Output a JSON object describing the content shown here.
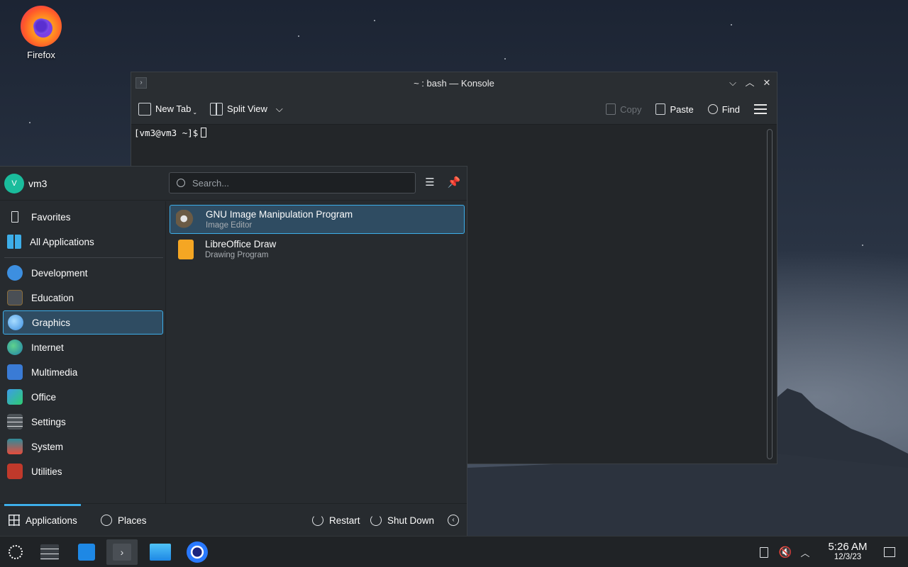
{
  "desktop": {
    "icons": [
      {
        "label": "Firefox",
        "icon": "firefox-icon"
      }
    ]
  },
  "konsole": {
    "title": "~ : bash — Konsole",
    "toolbar": {
      "new_tab": "New Tab",
      "split_view": "Split View",
      "copy": "Copy",
      "paste": "Paste",
      "find": "Find"
    },
    "prompt": "[vm3@vm3 ~]$"
  },
  "kickoff": {
    "user": {
      "initial": "V",
      "name": "vm3"
    },
    "search": {
      "placeholder": "Search..."
    },
    "categories_top": [
      {
        "label": "Favorites",
        "icon": "bookmark-icon"
      },
      {
        "label": "All Applications",
        "icon": "grid-icon"
      }
    ],
    "categories": [
      {
        "label": "Development",
        "icon": "development-icon",
        "color": "#3d8fe0"
      },
      {
        "label": "Education",
        "icon": "education-icon",
        "color": "#4a4f55"
      },
      {
        "label": "Graphics",
        "icon": "graphics-icon",
        "color": "#5aa9e6",
        "selected": true
      },
      {
        "label": "Internet",
        "icon": "globe-icon",
        "color": "#2fa3a8"
      },
      {
        "label": "Multimedia",
        "icon": "multimedia-icon",
        "color": "#3a7bd5"
      },
      {
        "label": "Office",
        "icon": "office-icon",
        "color": "#3d9be9"
      },
      {
        "label": "Settings",
        "icon": "settings-icon",
        "color": "#4d5358"
      },
      {
        "label": "System",
        "icon": "system-icon",
        "color": "#2e8b9a"
      },
      {
        "label": "Utilities",
        "icon": "toolbox-icon",
        "color": "#c0392b"
      }
    ],
    "apps": [
      {
        "name": "GNU Image Manipulation Program",
        "desc": "Image Editor",
        "icon": "gimp-icon",
        "selected": true
      },
      {
        "name": "LibreOffice Draw",
        "desc": "Drawing Program",
        "icon": "libreoffice-draw-icon"
      }
    ],
    "footer": {
      "applications": "Applications",
      "places": "Places",
      "restart": "Restart",
      "shutdown": "Shut Down"
    }
  },
  "taskbar": {
    "clock": {
      "time": "5:26 AM",
      "date": "12/3/23"
    }
  },
  "colors": {
    "accent": "#3daee9",
    "selection_bg": "#2f4c62"
  }
}
